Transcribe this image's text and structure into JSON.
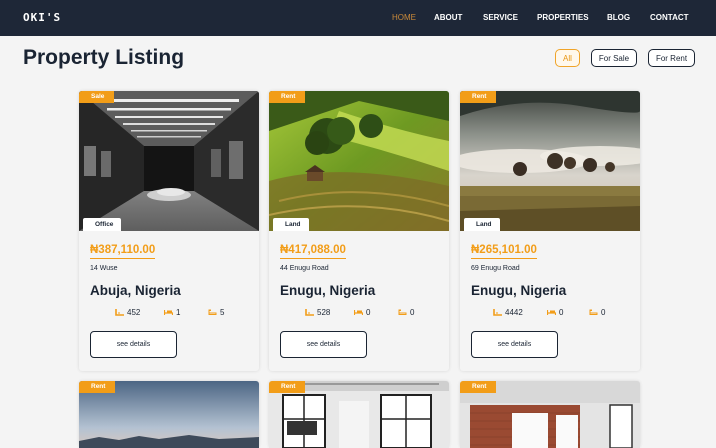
{
  "brand": {
    "logo": "OKI'S"
  },
  "nav": {
    "items": [
      {
        "label": "HOME"
      },
      {
        "label": "ABOUT"
      },
      {
        "label": "SERVICE"
      },
      {
        "label": "PROPERTIES"
      },
      {
        "label": "BLOG"
      },
      {
        "label": "CONTACT"
      }
    ]
  },
  "listing": {
    "title": "Property Listing",
    "filters": [
      {
        "label": "All"
      },
      {
        "label": "For Sale"
      },
      {
        "label": "For Rent"
      }
    ]
  },
  "cards": [
    {
      "tag": "Sale",
      "type": "Office",
      "price": "₦387,110.00",
      "street": "14 Wuse",
      "city": "Abuja, Nigeria",
      "stats": [
        "452",
        "1",
        "5"
      ],
      "button": "see details"
    },
    {
      "tag": "Rent",
      "type": "Land",
      "price": "₦417,088.00",
      "street": "44 Enugu Road",
      "city": "Enugu, Nigeria",
      "stats": [
        "528",
        "0",
        "0"
      ],
      "button": "see details"
    },
    {
      "tag": "Rent",
      "type": "Land",
      "price": "₦265,101.00",
      "street": "69 Enugu Road",
      "city": "Enugu, Nigeria",
      "stats": [
        "4442",
        "0",
        "0"
      ],
      "button": "see details"
    },
    {
      "tag": "Rent"
    },
    {
      "tag": "Rent"
    },
    {
      "tag": "Rent"
    }
  ],
  "colors": {
    "accent": "#f29d18",
    "nav_bg": "#1e2737",
    "text": "#1a2433"
  },
  "icons": [
    "area-icon",
    "bed-icon",
    "bath-icon"
  ]
}
